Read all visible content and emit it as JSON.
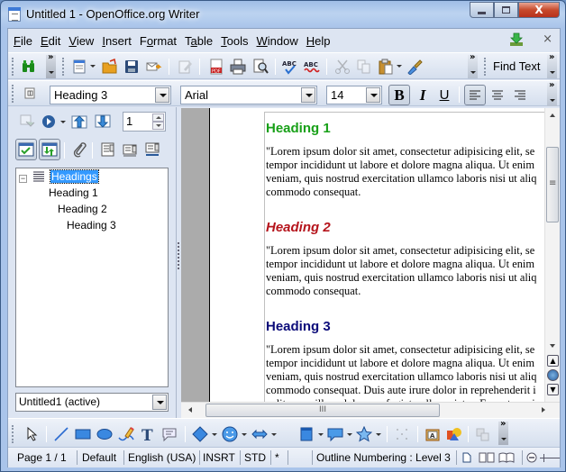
{
  "window": {
    "title": "Untitled 1 - OpenOffice.org Writer",
    "controls": {
      "minimize": "–",
      "maximize": "□",
      "close": "X"
    }
  },
  "menubar": {
    "items": [
      {
        "label": "File",
        "accel": "F",
        "rest": "ile"
      },
      {
        "label": "Edit",
        "accel": "E",
        "rest": "dit"
      },
      {
        "label": "View",
        "accel": "V",
        "rest": "iew"
      },
      {
        "label": "Insert",
        "accel": "I",
        "rest": "nsert"
      },
      {
        "label": "Format",
        "pre": "F",
        "accel": "o",
        "rest": "rmat"
      },
      {
        "label": "Table",
        "pre": "T",
        "accel": "a",
        "rest": "ble"
      },
      {
        "label": "Tools",
        "accel": "T",
        "rest": "ools"
      },
      {
        "label": "Window",
        "accel": "W",
        "rest": "indow"
      },
      {
        "label": "Help",
        "accel": "H",
        "rest": "elp"
      }
    ],
    "close_doc": "×"
  },
  "standard_toolbar": {
    "buttons": [
      "find-replace",
      "new",
      "open",
      "save",
      "email",
      "edit-file",
      "export-pdf",
      "print",
      "page-preview",
      "spellcheck",
      "autospellcheck",
      "cut",
      "copy",
      "paste",
      "clone-formatting"
    ],
    "find_text_label": "Find Text"
  },
  "formatting_toolbar": {
    "paragraph_style": "Heading 3",
    "font_name": "Arial",
    "font_size": "14",
    "bold_label": "B",
    "italic_label": "I",
    "underline_label": "U",
    "bold_active": true,
    "align_left_active": true
  },
  "navigator": {
    "page_number": "1",
    "tree": {
      "root": "Headings",
      "items": [
        {
          "label": "Heading 1",
          "level": 1
        },
        {
          "label": "Heading 2",
          "level": 2
        },
        {
          "label": "Heading 3",
          "level": 3
        }
      ]
    },
    "document_select": "Untitled1 (active)"
  },
  "document": {
    "sections": [
      {
        "heading": "Heading 1",
        "lines": [
          "\"Lorem ipsum dolor sit amet, consectetur adipisicing elit, se",
          "tempor incididunt ut labore et dolore magna aliqua. Ut enim",
          "veniam, quis nostrud exercitation ullamco laboris nisi ut aliq",
          "commodo consequat."
        ]
      },
      {
        "heading": "Heading 2",
        "lines": [
          "\"Lorem ipsum dolor sit amet, consectetur adipisicing elit, se",
          "tempor incididunt ut labore et dolore magna aliqua. Ut enim",
          "veniam, quis nostrud exercitation ullamco laboris nisi ut aliq",
          "commodo consequat."
        ]
      },
      {
        "heading": "Heading 3",
        "lines": [
          "\"Lorem ipsum dolor sit amet, consectetur adipisicing elit, se",
          "tempor incididunt ut labore et dolore magna aliqua. Ut enim",
          "veniam, quis nostrud exercitation ullamco laboris nisi ut aliq",
          "commodo consequat. Duis aute irure dolor in reprehenderit i",
          "velit esse cillum dolore eu fugiat nulla pariatur. Excepteur si"
        ]
      }
    ],
    "colors": {
      "heading1": "#18a018",
      "heading2": "#b5131b",
      "heading3": "#0c0c7a"
    }
  },
  "drawing_toolbar": {
    "buttons": [
      "select",
      "line",
      "rectangle",
      "ellipse",
      "freeform",
      "text",
      "callout",
      "basic-shapes",
      "symbol-shapes",
      "block-arrows",
      "flowchart",
      "callouts",
      "stars",
      "points",
      "fontwork",
      "from-file",
      "extrusion"
    ]
  },
  "statusbar": {
    "page": "Page 1 / 1",
    "style": "Default",
    "language": "English (USA)",
    "insert_mode": "INSRT",
    "selection_mode": "STD",
    "modified": "*",
    "outline": "Outline Numbering : Level 3"
  }
}
